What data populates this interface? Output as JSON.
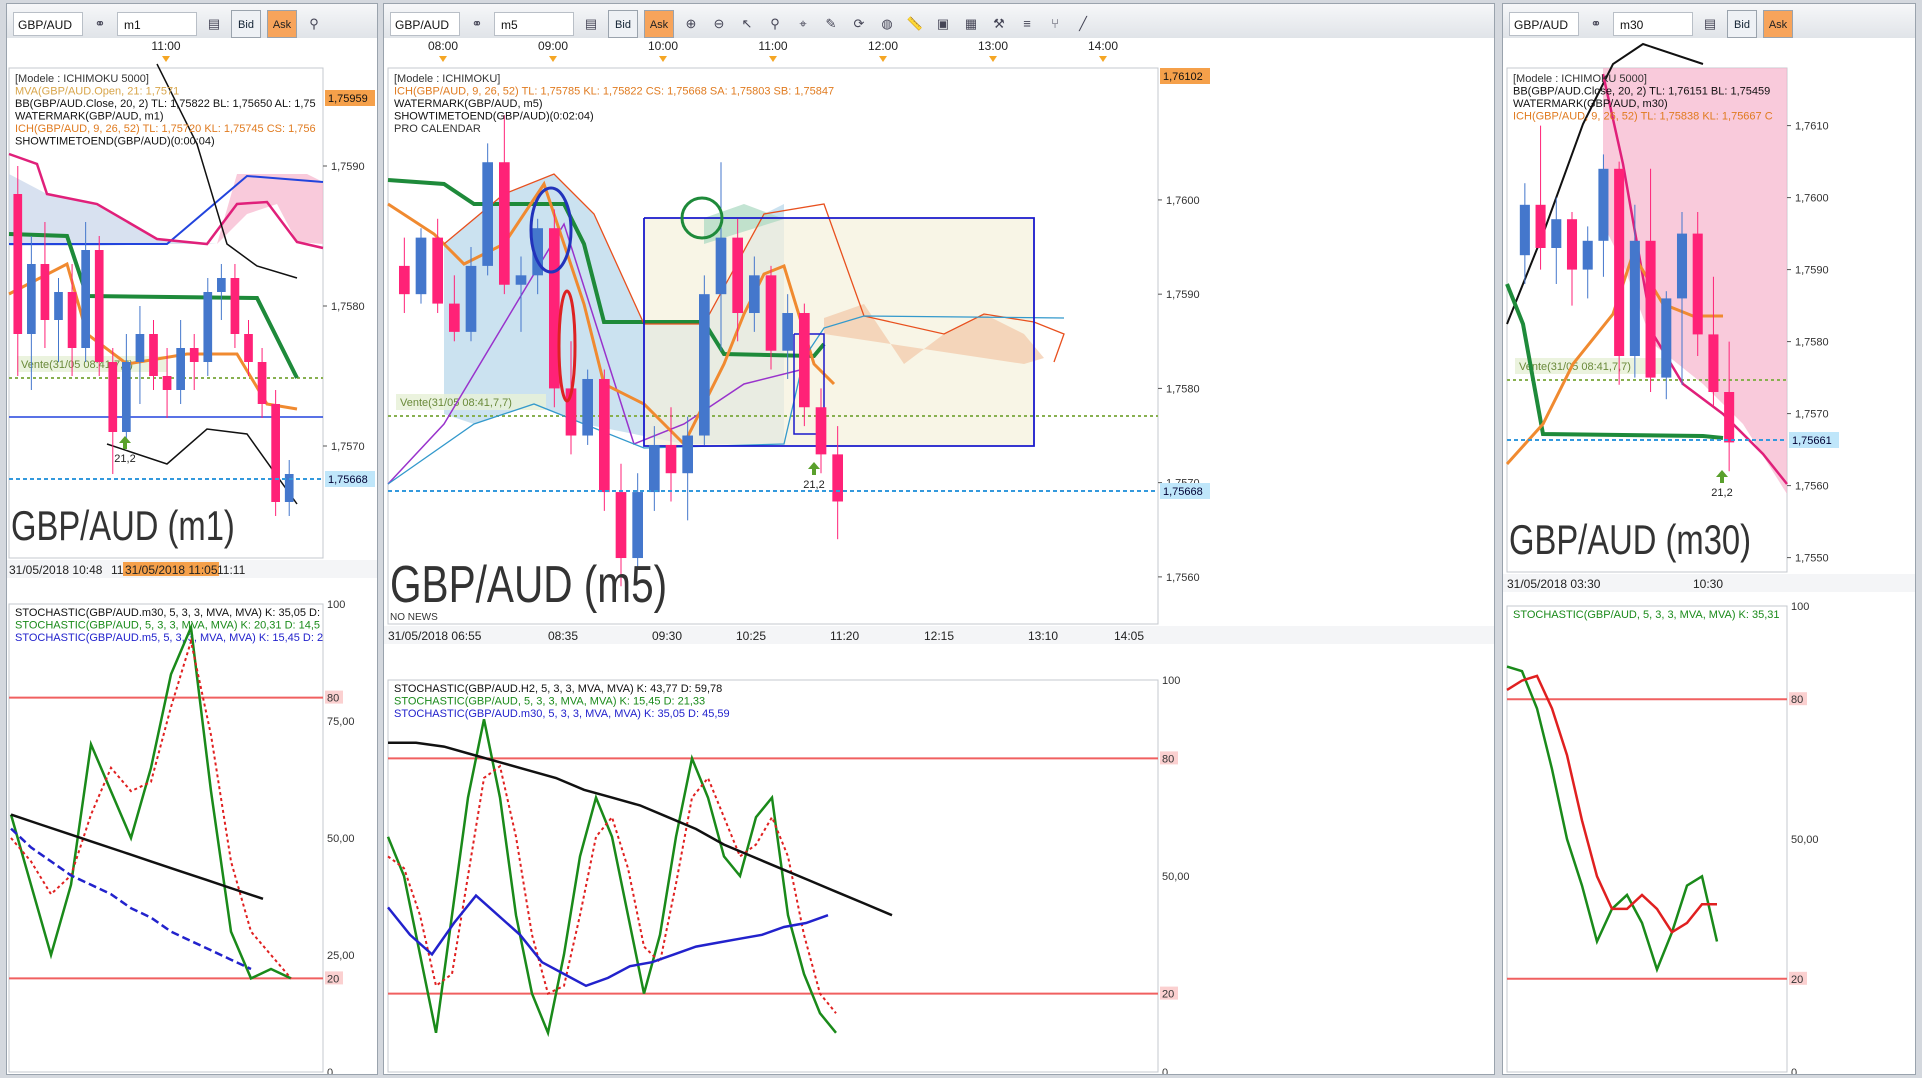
{
  "app": {
    "symbol": "GBP/AUD",
    "bid_label": "Bid",
    "ask_label": "Ask"
  },
  "colors": {
    "bull": "#4477cc",
    "bear": "#ff2277",
    "ichi_kijun": "#1e8a3a",
    "ichi_tenkan": "#f08a30",
    "cloud_bear": "#f4b7c8",
    "cloud_bull": "#b7d4e8",
    "bb": "#111111",
    "price_line": "#3399dd",
    "stoch_k": "#1a8a1a",
    "stoch_d": "#e02020",
    "level_line": "#f06060",
    "blue_line": "#2222cc"
  },
  "panels": [
    {
      "id": "m1",
      "timeframe": "m1",
      "watermark": "GBP/AUD (m1)",
      "time_top": [
        "11:00"
      ],
      "indicators": [
        "[Modele : ICHIMOKU 5000]",
        "MVA(GBP/AUD.Open, 21: 1,7571",
        "BB(GBP/AUD.Close, 20, 2)  TL: 1,75822  BL: 1,75650  AL: 1,75",
        "WATERMARK(GBP/AUD, m1)",
        "ICH(GBP/AUD, 9, 26, 52)  TL: 1,75720  KL: 1,75745  CS: 1,756",
        "SHOWTIMETOEND(GBP/AUD)(0:00:04)"
      ],
      "price_ticks": [
        "1,7590",
        "1,7580",
        "1,7570"
      ],
      "price_badge_top": "1,75959",
      "price_badge_last": "1,75668",
      "order_label": "Vente(31/05 08:41,7,7)",
      "arrow_value": "21,2",
      "date_bottom": [
        "31/05/2018 10:48",
        "11",
        "31/05/2018 11:05",
        "11:11"
      ],
      "stoch": {
        "lines": [
          "STOCHASTIC(GBP/AUD.m30, 5, 3, 3, MVA, MVA)  K: 35,05  D:",
          "STOCHASTIC(GBP/AUD, 5, 3, 3, MVA, MVA)  K: 20,31  D: 14,5",
          "STOCHASTIC(GBP/AUD.m5, 5, 3, 3, MVA, MVA)  K: 15,45  D: 2"
        ],
        "ticks": [
          "100",
          "80",
          "75,00",
          "50,00",
          "25,00",
          "20",
          "0"
        ]
      }
    },
    {
      "id": "m5",
      "timeframe": "m5",
      "watermark": "GBP/AUD (m5)",
      "no_news": "NO NEWS",
      "time_top": [
        "08:00",
        "09:00",
        "10:00",
        "11:00",
        "12:00",
        "13:00",
        "14:00"
      ],
      "indicators": [
        "[Modele : ICHIMOKU]",
        "ICH(GBP/AUD, 9, 26, 52)  TL: 1,75785  KL: 1,75822  CS: 1,75668  SA: 1,75803  SB: 1,75847",
        "WATERMARK(GBP/AUD, m5)",
        "SHOWTIMETOEND(GBP/AUD)(0:02:04)",
        "PRO CALENDAR"
      ],
      "price_ticks": [
        "1,7600",
        "1,7590",
        "1,7580",
        "1,7570",
        "1,7560"
      ],
      "price_badge_top": "1,76102",
      "price_badge_last": "1,75668",
      "order_label": "Vente(31/05 08:41,7,7)",
      "arrow_value": "21,2",
      "date_bottom": [
        "31/05/2018 06:55",
        "08:35",
        "09:30",
        "10:25",
        "11:20",
        "12:15",
        "13:10",
        "14:05"
      ],
      "stoch": {
        "lines": [
          "STOCHASTIC(GBP/AUD.H2, 5, 3, 3, MVA, MVA)  K: 43,77  D: 59,78",
          "STOCHASTIC(GBP/AUD, 5, 3, 3, MVA, MVA)  K: 15,45  D: 21,33",
          "STOCHASTIC(GBP/AUD.m30, 5, 3, 3, MVA, MVA)  K: 35,05  D: 45,59"
        ],
        "ticks": [
          "100",
          "80",
          "50,00",
          "20",
          "0"
        ]
      }
    },
    {
      "id": "m30",
      "timeframe": "m30",
      "watermark": "GBP/AUD (m30)",
      "indicators": [
        "[Modele : ICHIMOKU 5000]",
        "BB(GBP/AUD.Close, 20, 2)  TL: 1,76151  BL: 1,75459",
        "WATERMARK(GBP/AUD, m30)",
        "ICH(GBP/AUD, 9, 26, 52)  TL: 1,75838  KL: 1,75667  C"
      ],
      "price_ticks": [
        "1,7610",
        "1,7600",
        "1,7590",
        "1,7580",
        "1,7570",
        "1,7560",
        "1,7550"
      ],
      "price_badge_last": "1,75661",
      "order_label": "Vente(31/05 08:41,7,7)",
      "arrow_value": "21,2",
      "date_bottom": [
        "31/05/2018 03:30",
        "10:30"
      ],
      "stoch": {
        "lines": [
          "STOCHASTIC(GBP/AUD, 5, 3, 3, MVA, MVA)  K: 35,31"
        ],
        "ticks": [
          "100",
          "80",
          "50,00",
          "20",
          "0"
        ]
      }
    }
  ],
  "chart_data": [
    {
      "type": "candlestick",
      "name": "GBP/AUD m1",
      "ylim": [
        1.7562,
        1.7597
      ],
      "candles": [
        [
          1.7588,
          1.759,
          1.7575,
          1.7578
        ],
        [
          1.7578,
          1.7585,
          1.7574,
          1.7583
        ],
        [
          1.7583,
          1.7586,
          1.7577,
          1.7579
        ],
        [
          1.7579,
          1.7582,
          1.7576,
          1.7581
        ],
        [
          1.7581,
          1.7583,
          1.7575,
          1.7577
        ],
        [
          1.7577,
          1.7586,
          1.7576,
          1.7584
        ],
        [
          1.7584,
          1.7585,
          1.7575,
          1.7576
        ],
        [
          1.7576,
          1.7577,
          1.7568,
          1.7571
        ],
        [
          1.7571,
          1.7578,
          1.757,
          1.7576
        ],
        [
          1.7576,
          1.758,
          1.7573,
          1.7578
        ],
        [
          1.7578,
          1.7579,
          1.7574,
          1.7575
        ],
        [
          1.7575,
          1.7577,
          1.7572,
          1.7574
        ],
        [
          1.7574,
          1.7579,
          1.7573,
          1.7577
        ],
        [
          1.7577,
          1.7578,
          1.7574,
          1.7576
        ],
        [
          1.7576,
          1.7582,
          1.7575,
          1.7581
        ],
        [
          1.7581,
          1.7583,
          1.7579,
          1.7582
        ],
        [
          1.7582,
          1.7583,
          1.7577,
          1.7578
        ],
        [
          1.7578,
          1.7579,
          1.7575,
          1.7576
        ],
        [
          1.7576,
          1.7577,
          1.7572,
          1.7573
        ],
        [
          1.7573,
          1.7574,
          1.7565,
          1.7566
        ],
        [
          1.7566,
          1.7569,
          1.7565,
          1.7568
        ]
      ]
    },
    {
      "type": "candlestick",
      "name": "GBP/AUD m5",
      "ylim": [
        1.7555,
        1.7614
      ],
      "candles": [
        [
          1.7593,
          1.7596,
          1.7588,
          1.759
        ],
        [
          1.759,
          1.7597,
          1.7589,
          1.7596
        ],
        [
          1.7596,
          1.7598,
          1.7588,
          1.7589
        ],
        [
          1.7589,
          1.7592,
          1.7585,
          1.7586
        ],
        [
          1.7586,
          1.7595,
          1.7585,
          1.7593
        ],
        [
          1.7593,
          1.7606,
          1.7592,
          1.7604
        ],
        [
          1.7604,
          1.7609,
          1.759,
          1.7591
        ],
        [
          1.7591,
          1.7594,
          1.7586,
          1.7592
        ],
        [
          1.7592,
          1.7598,
          1.759,
          1.7597
        ],
        [
          1.7597,
          1.7599,
          1.7578,
          1.758
        ],
        [
          1.758,
          1.7585,
          1.7573,
          1.7575
        ],
        [
          1.7575,
          1.7582,
          1.7574,
          1.7581
        ],
        [
          1.7581,
          1.7582,
          1.7567,
          1.7569
        ],
        [
          1.7569,
          1.7572,
          1.7559,
          1.7562
        ],
        [
          1.7562,
          1.7571,
          1.7561,
          1.7569
        ],
        [
          1.7569,
          1.7576,
          1.7567,
          1.7574
        ],
        [
          1.7574,
          1.7578,
          1.7568,
          1.7571
        ],
        [
          1.7571,
          1.7577,
          1.7566,
          1.7575
        ],
        [
          1.7575,
          1.7592,
          1.7574,
          1.759
        ],
        [
          1.759,
          1.7604,
          1.7584,
          1.7596
        ],
        [
          1.7596,
          1.7598,
          1.7585,
          1.7588
        ],
        [
          1.7588,
          1.7594,
          1.7586,
          1.7592
        ],
        [
          1.7592,
          1.7593,
          1.7582,
          1.7584
        ],
        [
          1.7584,
          1.759,
          1.7581,
          1.7588
        ],
        [
          1.7588,
          1.7589,
          1.7576,
          1.7578
        ],
        [
          1.7578,
          1.758,
          1.7571,
          1.7573
        ],
        [
          1.7573,
          1.7576,
          1.7564,
          1.7568
        ]
      ]
    },
    {
      "type": "candlestick",
      "name": "GBP/AUD m30",
      "ylim": [
        1.7548,
        1.7618
      ],
      "candles": [
        [
          1.7592,
          1.7602,
          1.7588,
          1.7599
        ],
        [
          1.7599,
          1.761,
          1.759,
          1.7593
        ],
        [
          1.7593,
          1.76,
          1.7588,
          1.7597
        ],
        [
          1.7597,
          1.7598,
          1.7585,
          1.759
        ],
        [
          1.759,
          1.7596,
          1.7586,
          1.7594
        ],
        [
          1.7594,
          1.7606,
          1.7589,
          1.7604
        ],
        [
          1.7604,
          1.7605,
          1.7574,
          1.7578
        ],
        [
          1.7578,
          1.7599,
          1.7575,
          1.7594
        ],
        [
          1.7594,
          1.7604,
          1.7573,
          1.7575
        ],
        [
          1.7575,
          1.7587,
          1.7572,
          1.7586
        ],
        [
          1.7586,
          1.7598,
          1.7574,
          1.7595
        ],
        [
          1.7595,
          1.7598,
          1.7578,
          1.7581
        ],
        [
          1.7581,
          1.7589,
          1.7571,
          1.7573
        ],
        [
          1.7573,
          1.758,
          1.7562,
          1.7566
        ]
      ]
    }
  ]
}
